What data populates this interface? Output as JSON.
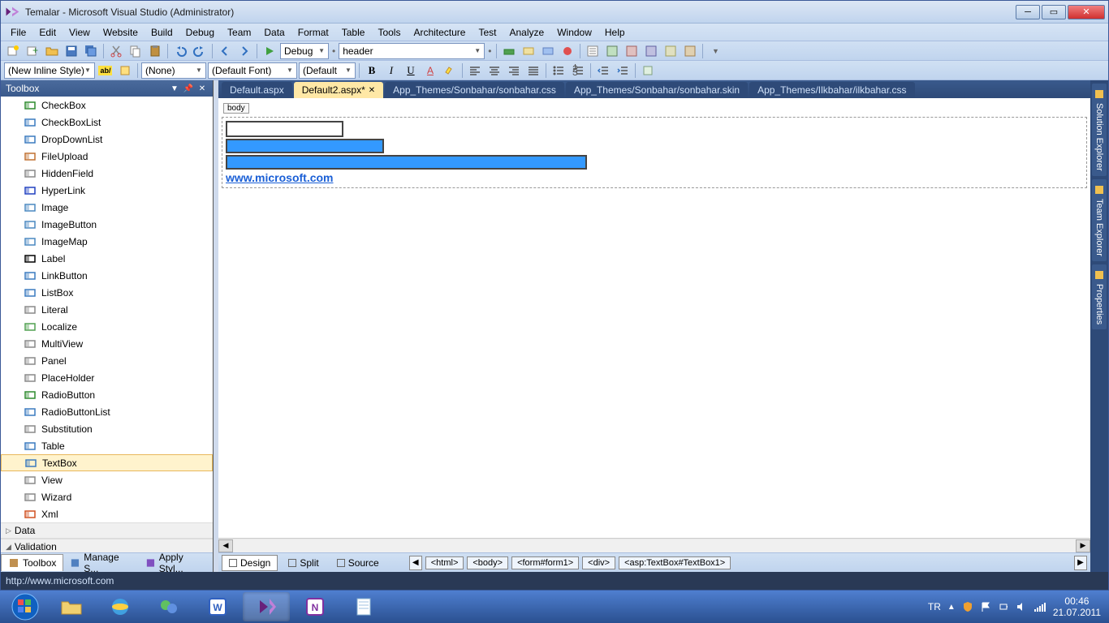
{
  "window": {
    "title": "Temalar - Microsoft Visual Studio (Administrator)"
  },
  "menu": [
    "File",
    "Edit",
    "View",
    "Website",
    "Build",
    "Debug",
    "Team",
    "Data",
    "Format",
    "Table",
    "Tools",
    "Architecture",
    "Test",
    "Analyze",
    "Window",
    "Help"
  ],
  "toolbar1": {
    "config": "Debug",
    "target": "header"
  },
  "toolbar2": {
    "style": "(New Inline Style)",
    "rule": "(None)",
    "font": "(Default Font)",
    "size": "(Default"
  },
  "toolbox": {
    "title": "Toolbox",
    "items": [
      {
        "label": "CheckBox",
        "color": "#2e8b2e"
      },
      {
        "label": "CheckBoxList",
        "color": "#3a7abf"
      },
      {
        "label": "DropDownList",
        "color": "#3a7abf"
      },
      {
        "label": "FileUpload",
        "color": "#c07030"
      },
      {
        "label": "HiddenField",
        "color": "#888"
      },
      {
        "label": "HyperLink",
        "color": "#2040c0"
      },
      {
        "label": "Image",
        "color": "#4a88c0"
      },
      {
        "label": "ImageButton",
        "color": "#4a88c0"
      },
      {
        "label": "ImageMap",
        "color": "#4a88c0"
      },
      {
        "label": "Label",
        "color": "#000"
      },
      {
        "label": "LinkButton",
        "color": "#3a7abf"
      },
      {
        "label": "ListBox",
        "color": "#3a7abf"
      },
      {
        "label": "Literal",
        "color": "#888"
      },
      {
        "label": "Localize",
        "color": "#50a050"
      },
      {
        "label": "MultiView",
        "color": "#888"
      },
      {
        "label": "Panel",
        "color": "#888"
      },
      {
        "label": "PlaceHolder",
        "color": "#888"
      },
      {
        "label": "RadioButton",
        "color": "#2e8b2e"
      },
      {
        "label": "RadioButtonList",
        "color": "#3a7abf"
      },
      {
        "label": "Substitution",
        "color": "#888"
      },
      {
        "label": "Table",
        "color": "#3a7abf"
      },
      {
        "label": "TextBox",
        "color": "#3a7abf",
        "selected": true
      },
      {
        "label": "View",
        "color": "#888"
      },
      {
        "label": "Wizard",
        "color": "#888"
      },
      {
        "label": "Xml",
        "color": "#d05020"
      }
    ],
    "groups": [
      "Data",
      "Validation"
    ],
    "tabs": [
      "Toolbox",
      "Manage S...",
      "Apply Styl..."
    ]
  },
  "tabs": [
    {
      "label": "Default.aspx"
    },
    {
      "label": "Default2.aspx*",
      "active": true,
      "closeable": true
    },
    {
      "label": "App_Themes/Sonbahar/sonbahar.css"
    },
    {
      "label": "App_Themes/Sonbahar/sonbahar.skin"
    },
    {
      "label": "App_Themes/Ilkbahar/ilkbahar.css"
    }
  ],
  "designer": {
    "tag": "body",
    "link": "www.microsoft.com",
    "button1_width": 195,
    "button2_width": 445
  },
  "viewBar": {
    "modes": [
      "Design",
      "Split",
      "Source"
    ],
    "active": "Design",
    "path": [
      "<html>",
      "<body>",
      "<form#form1>",
      "<div>",
      "<asp:TextBox#TextBox1>"
    ]
  },
  "rightRail": [
    "Solution Explorer",
    "Team Explorer",
    "Properties"
  ],
  "status": "http://www.microsoft.com",
  "tray": {
    "lang": "TR",
    "time": "00:46",
    "date": "21.07.2011"
  }
}
